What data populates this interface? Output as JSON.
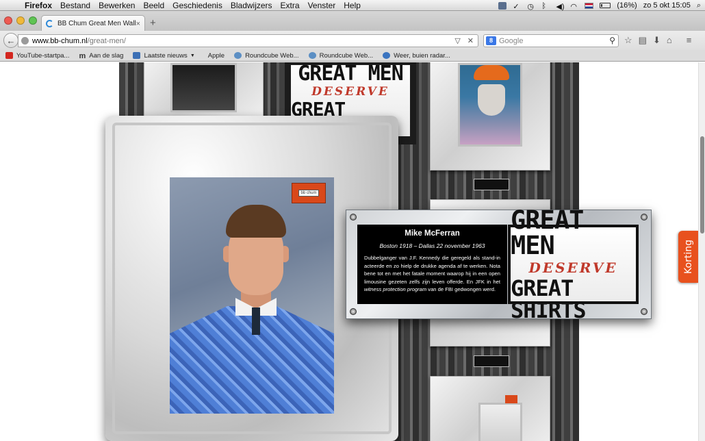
{
  "menubar": {
    "app": "Firefox",
    "items": [
      "Bestand",
      "Bewerken",
      "Beeld",
      "Geschiedenis",
      "Bladwijzers",
      "Extra",
      "Venster",
      "Help"
    ],
    "battery": "(16%)",
    "datetime": "zo 5 okt  15:05"
  },
  "tab": {
    "title": "BB Chum Great Men Wall ...",
    "close": "×",
    "new_tab": "+"
  },
  "urlbar": {
    "host": "www.bb-chum.nl",
    "path": "/great-men/",
    "clear": "✕",
    "dropdown": "▽"
  },
  "search": {
    "engine": "8",
    "placeholder": "Google"
  },
  "bookmarks": [
    {
      "label": "YouTube-startpa...",
      "icon": "youtube-icon"
    },
    {
      "label": "Aan de slag",
      "icon": "getting-started-icon"
    },
    {
      "label": "Laatste nieuws",
      "icon": "rss-icon"
    },
    {
      "label": "Apple",
      "icon": "apple-icon"
    },
    {
      "label": "Roundcube Web...",
      "icon": "roundcube-icon"
    },
    {
      "label": "Roundcube Web...",
      "icon": "roundcube-icon"
    },
    {
      "label": "Weer, buien radar...",
      "icon": "weather-icon"
    }
  ],
  "poster": {
    "line1": "GREAT MEN",
    "line2": "DESERVE",
    "line3": "GREAT SHIRTS"
  },
  "photo": {
    "brand": "bb chum"
  },
  "plaque": {
    "name": "Mike McFerran",
    "dates": "Boston 1918 – Dallas 22 november 1963",
    "bio_part1": "Dubbelganger van J.F. Kennedy die geregeld als stand-in acteerde en zo hielp de drukke agenda af te werken. Nota bene tot en met het fatale moment waarop hij in een open limousine gezeten zelfs zijn leven offerde. En JFK in het ",
    "bio_em": "witness protection program",
    "bio_part2": " van de FBI gedwongen werd."
  },
  "side_tab": {
    "label": "Korting"
  },
  "colors": {
    "accent_orange": "#e8511e",
    "title_red": "#c0392b"
  }
}
